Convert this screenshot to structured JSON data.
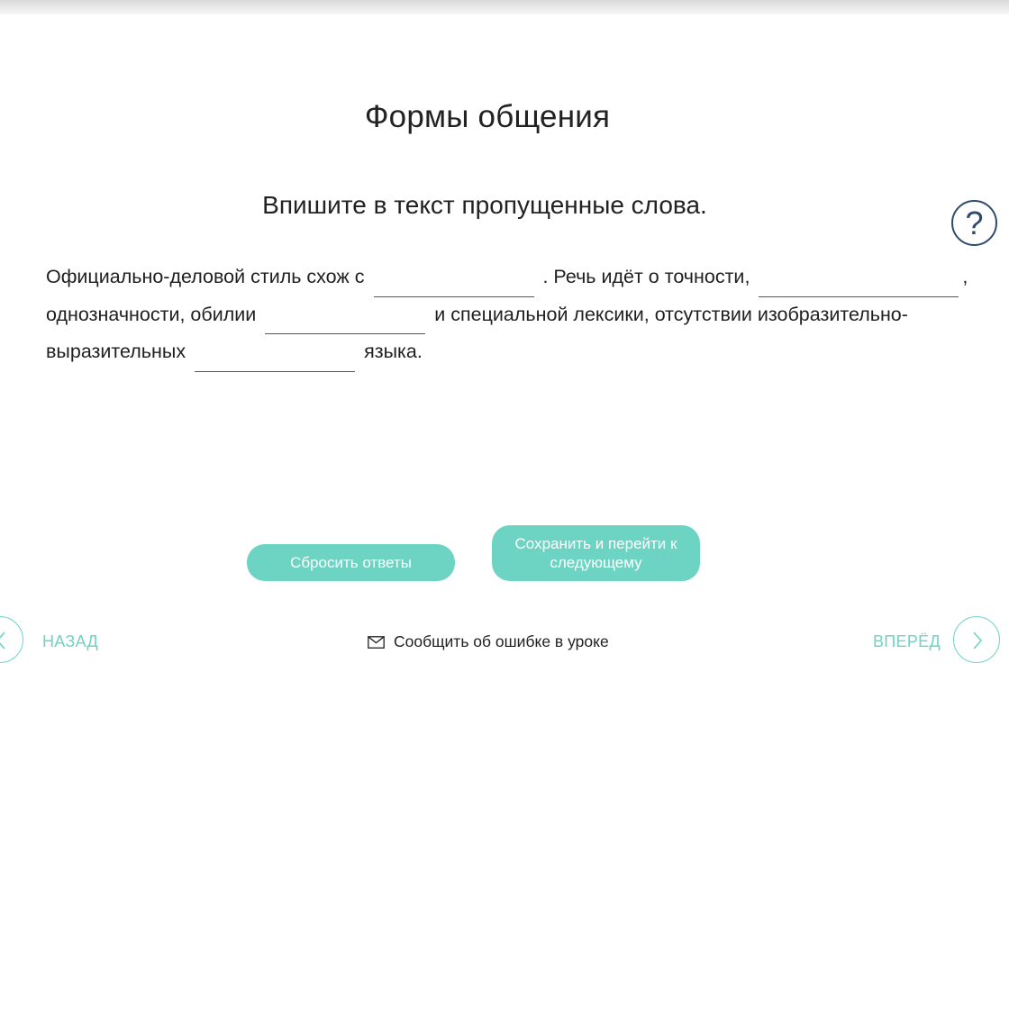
{
  "header": {
    "title": "Формы общения",
    "instruction": "Впишите в текст пропущенные слова."
  },
  "help": {
    "symbol": "?",
    "icon": "question-icon"
  },
  "exercise": {
    "seg1": "Официально-деловой стиль схож с",
    "seg2": ". Речь идёт о точности,",
    "seg3": ",",
    "seg4": "однозначности, обилии",
    "seg5": "и специальной лексики, отсутствии изобразительно-",
    "seg6": "выразительных",
    "seg7": "языка.",
    "gaps": [
      {
        "value": ""
      },
      {
        "value": ""
      },
      {
        "value": ""
      },
      {
        "value": ""
      }
    ]
  },
  "buttons": {
    "reset": "Сбросить ответы",
    "save": "Сохранить и перейти к следующему"
  },
  "nav": {
    "back": "НАЗАД",
    "next": "ВПЕРЁД",
    "report": "Сообщить об ошибке в уроке"
  },
  "colors": {
    "accent": "#6dd4c3",
    "help": "#2f4a6d",
    "text": "#1f1f1f"
  }
}
